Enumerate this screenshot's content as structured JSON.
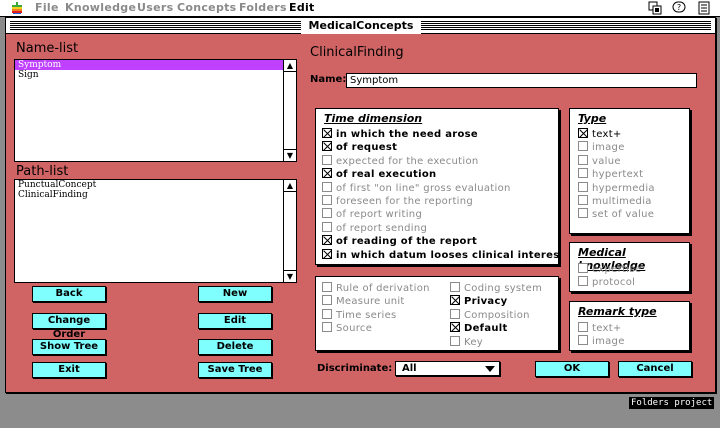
{
  "menubar": {
    "items": [
      "File",
      "Knowledge",
      "Users",
      "Concepts",
      "Folders",
      "Edit"
    ]
  },
  "window": {
    "title": "MedicalConcepts"
  },
  "name_list": {
    "label": "Name-list",
    "items": [
      "Symptom",
      "Sign"
    ],
    "selected": "Symptom"
  },
  "path_list": {
    "label": "Path-list",
    "items": [
      "PunctualConcept",
      "ClinicalFinding"
    ]
  },
  "buttons": {
    "back": "Back",
    "new": "New",
    "change_order": "Change Order",
    "edit": "Edit",
    "show_tree": "Show Tree",
    "delete": "Delete",
    "exit": "Exit",
    "save_tree": "Save Tree",
    "ok": "OK",
    "cancel": "Cancel"
  },
  "form": {
    "heading": "ClinicalFinding",
    "name_label": "Name:",
    "name_value": "Symptom"
  },
  "time_dimension": {
    "title": "Time dimension",
    "options": [
      {
        "label": "in which the need arose",
        "checked": true,
        "enabled": true
      },
      {
        "label": "of request",
        "checked": true,
        "enabled": true
      },
      {
        "label": "expected for the execution",
        "checked": false,
        "enabled": false
      },
      {
        "label": "of real execution",
        "checked": true,
        "enabled": true
      },
      {
        "label": "of first \"on line\" gross evaluation",
        "checked": false,
        "enabled": false
      },
      {
        "label": "foreseen for the reporting",
        "checked": false,
        "enabled": false
      },
      {
        "label": "of report writing",
        "checked": false,
        "enabled": false
      },
      {
        "label": "of report sending",
        "checked": false,
        "enabled": false
      },
      {
        "label": "of reading of the report",
        "checked": true,
        "enabled": true
      },
      {
        "label": "in which datum looses clinical interes",
        "checked": true,
        "enabled": true
      }
    ]
  },
  "type": {
    "title": "Type",
    "options": [
      {
        "label": "text+",
        "checked": true,
        "enabled": true
      },
      {
        "label": "image",
        "checked": false,
        "enabled": false
      },
      {
        "label": "value",
        "checked": false,
        "enabled": false
      },
      {
        "label": "hypertext",
        "checked": false,
        "enabled": false
      },
      {
        "label": "hypermedia",
        "checked": false,
        "enabled": false
      },
      {
        "label": "multimedia",
        "checked": false,
        "enabled": false
      },
      {
        "label": "set of value",
        "checked": false,
        "enabled": false
      }
    ]
  },
  "medical_knowledge": {
    "title": "Medical knowledge",
    "options": [
      {
        "label": "expertise",
        "checked": false,
        "enabled": false
      },
      {
        "label": "protocol",
        "checked": false,
        "enabled": false
      }
    ]
  },
  "remark_type": {
    "title": "Remark type",
    "options": [
      {
        "label": "text+",
        "checked": false,
        "enabled": false
      },
      {
        "label": "image",
        "checked": false,
        "enabled": false
      }
    ]
  },
  "attributes": {
    "left": [
      {
        "label": "Rule of derivation",
        "checked": false,
        "enabled": false
      },
      {
        "label": "Measure unit",
        "checked": false,
        "enabled": false
      },
      {
        "label": "Time series",
        "checked": false,
        "enabled": false
      },
      {
        "label": "Source",
        "checked": false,
        "enabled": false
      }
    ],
    "right": [
      {
        "label": "Coding system",
        "checked": false,
        "enabled": false
      },
      {
        "label": "Privacy",
        "checked": true,
        "enabled": true
      },
      {
        "label": "Composition",
        "checked": false,
        "enabled": false
      },
      {
        "label": "Default",
        "checked": true,
        "enabled": true
      },
      {
        "label": "Key",
        "checked": false,
        "enabled": false
      }
    ]
  },
  "discriminate": {
    "label": "Discriminate:",
    "value": "All"
  },
  "status": {
    "tooltip": "Folders project"
  },
  "colors": {
    "window_bg": "#d06464",
    "button_bg": "#80ffff",
    "selection": "#c040ff",
    "desktop": "#8c8c8c"
  }
}
